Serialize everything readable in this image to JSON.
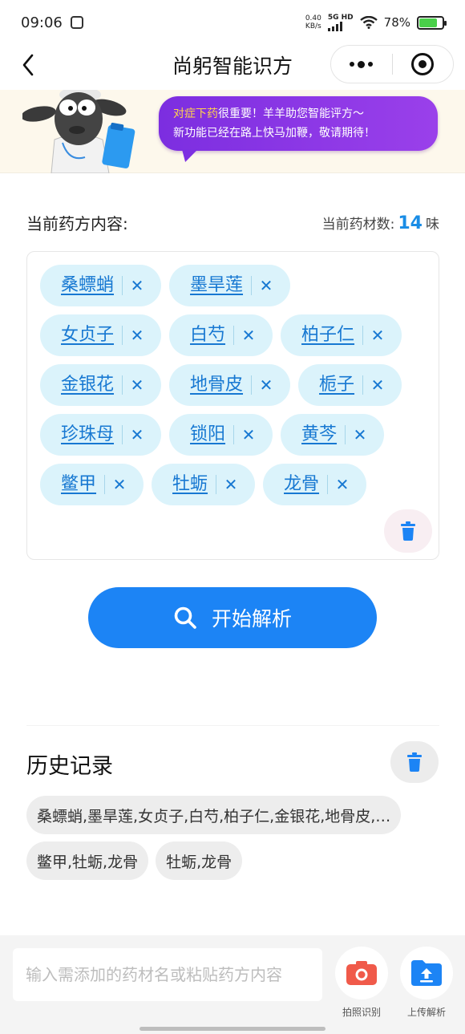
{
  "status_bar": {
    "time": "09:06",
    "net_speed_value": "0.40",
    "net_speed_unit": "KB/s",
    "network": "5G HD",
    "battery": "78%",
    "battery_level": 0.78
  },
  "nav": {
    "title": "尚躬智能识方"
  },
  "banner": {
    "highlight": "对症下药",
    "line1_rest": "很重要！羊羊助您智能评方～",
    "line2": "新功能已经在路上快马加鞭，敬请期待！"
  },
  "prescription": {
    "title": "当前药方内容:",
    "count_label": "当前药材数:",
    "count": "14",
    "count_unit": "味",
    "herbs": [
      "桑螵蛸",
      "墨旱莲",
      "女贞子",
      "白芍",
      "柏子仁",
      "金银花",
      "地骨皮",
      "栀子",
      "珍珠母",
      "锁阳",
      "黄芩",
      "鳖甲",
      "牡蛎",
      "龙骨"
    ],
    "remove_symbol": "✕"
  },
  "analyze": {
    "label": "开始解析"
  },
  "history": {
    "title": "历史记录",
    "items": [
      "桑螵蛸,墨旱莲,女贞子,白芍,柏子仁,金银花,地骨皮,…",
      "鳖甲,牡蛎,龙骨",
      "牡蛎,龙骨"
    ]
  },
  "bottom": {
    "placeholder": "输入需添加的药材名或粘贴药方内容",
    "camera_label": "拍照识别",
    "upload_label": "上传解析"
  },
  "colors": {
    "accent": "#1c84f5",
    "tag_bg": "#dbf3fb",
    "tag_text": "#1778d2",
    "bubble": "#8a36e6",
    "camera": "#f05a4a"
  }
}
